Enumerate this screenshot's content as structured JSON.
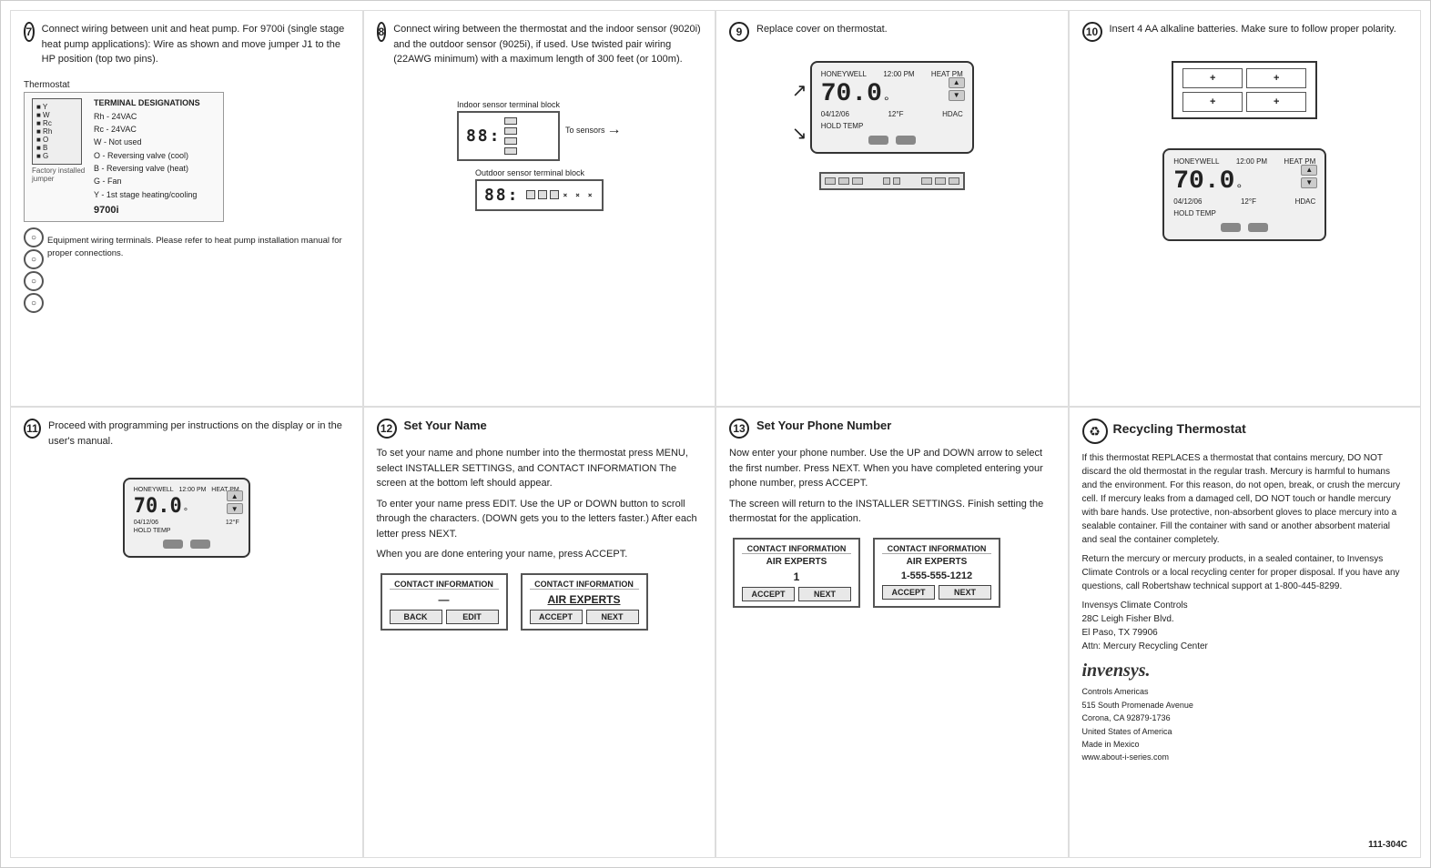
{
  "steps": {
    "step7": {
      "num": "7",
      "text": "Connect wiring between unit and heat pump. For 9700i (single stage heat pump applications): Wire as shown and move jumper J1 to the HP position (top two pins).",
      "labels": {
        "thermostat": "Thermostat",
        "factory_jumper": "Factory installed jumper",
        "terminal_designations": "TERMINAL DESIGNATIONS",
        "rh": "Rh - 24VAC",
        "rc": "Rc - 24VAC",
        "w": "W  - Not used",
        "o": "O  - Reversing valve (cool)",
        "b": "B  - Reversing valve (heat)",
        "g": "G  - Fan",
        "y": "Y  - 1st stage heating/cooling",
        "model": "9700i",
        "equipment_wiring": "Equipment wiring terminals. Please refer to heat pump installation manual for proper connections."
      }
    },
    "step8": {
      "num": "8",
      "text": "Connect wiring between the thermostat and the indoor sensor (9020i) and the outdoor sensor (9025i), if used. Use twisted pair wiring (22AWG minimum) with a maximum length of 300 feet (or 100m).",
      "labels": {
        "indoor_sensor": "Indoor sensor terminal block",
        "to_sensors": "To sensors",
        "outdoor_sensor": "Outdoor sensor terminal block"
      }
    },
    "step9": {
      "num": "9",
      "text": "Replace cover on thermostat."
    },
    "step10": {
      "num": "10",
      "text": "Insert 4 AA alkaline batteries. Make sure to follow proper polarity.",
      "battery_cells": [
        "+",
        "+",
        "+",
        "+"
      ]
    },
    "step11": {
      "num": "11",
      "text": "Proceed with programming per instructions on the display or in the user's manual."
    },
    "step12": {
      "num": "12",
      "title": "Set Your Name",
      "paragraphs": [
        "To set your name and phone number into the thermostat press MENU, select INSTALLER SETTINGS, and CONTACT INFORMATION The screen at the bottom left should appear.",
        "To enter your name press EDIT. Use the UP or DOWN button to scroll through the characters. (DOWN gets you to the letters faster.) After each letter press NEXT.",
        "When you are done entering your name, press ACCEPT."
      ],
      "screens": [
        {
          "title": "CONTACT INFORMATION",
          "value": "—",
          "buttons": [
            "BACK",
            "EDIT"
          ]
        },
        {
          "title": "CONTACT INFORMATION",
          "subtitle": "AIR EXPERTS",
          "value": "",
          "buttons": [
            "ACCEPT",
            "NEXT"
          ]
        }
      ]
    },
    "step13": {
      "num": "13",
      "title": "Set Your Phone Number",
      "paragraphs": [
        "Now enter your phone number. Use the UP and DOWN arrow to select the first number. Press NEXT. When you have completed entering your phone number, press ACCEPT.",
        "The screen will return to the INSTALLER SETTINGS. Finish setting the thermostat for the application."
      ],
      "screens": [
        {
          "title": "CONTACT INFORMATION",
          "subtitle": "AIR EXPERTS",
          "value": "1",
          "buttons": [
            "ACCEPT",
            "NEXT"
          ]
        },
        {
          "title": "CONTACT INFORMATION",
          "subtitle": "AIR EXPERTS",
          "phone": "1-555-555-1212",
          "buttons": [
            "ACCEPT",
            "NEXT"
          ]
        }
      ]
    },
    "stepR": {
      "title": "Recycling Thermostat",
      "icon": "♻",
      "paragraphs": [
        "If this thermostat REPLACES a thermostat that contains mercury, DO NOT discard the old thermostat in the regular trash. Mercury is harmful to humans and the environment. For this reason, do not open, break, or crush the mercury cell. If mercury leaks from a damaged cell, DO NOT touch or handle mercury with bare hands. Use protective, non-absorbent gloves to place mercury into a sealable container. Fill the container with sand or another absorbent material and seal the container completely.",
        "Return the mercury or mercury products, in a sealed container, to Invensys Climate Controls or a local recycling center for proper disposal. If you have any questions, call Robertshaw technical support at 1-800-445-8299."
      ],
      "company_name": "Invensys Climate Controls",
      "address1": "28C Leigh Fisher Blvd.",
      "address2": "El Paso, TX 79906",
      "attn": "Attn: Mercury Recycling Center",
      "logo": "invensys.",
      "logo_sub": "Controls Americas",
      "addr_full": "515 South Promenade Avenue\nCorona, CA 92879-1736\nUnited States of America\nMade in Mexico\nwww.about-i-series.com",
      "doc_number": "111-304C"
    }
  },
  "thermostat_display": {
    "temp": "70.0",
    "unit": "°",
    "label": "HEAT PM",
    "date": "04/12/06",
    "set": "12°F",
    "hold": "HOLD TEMP",
    "hdac": "HDAC"
  }
}
